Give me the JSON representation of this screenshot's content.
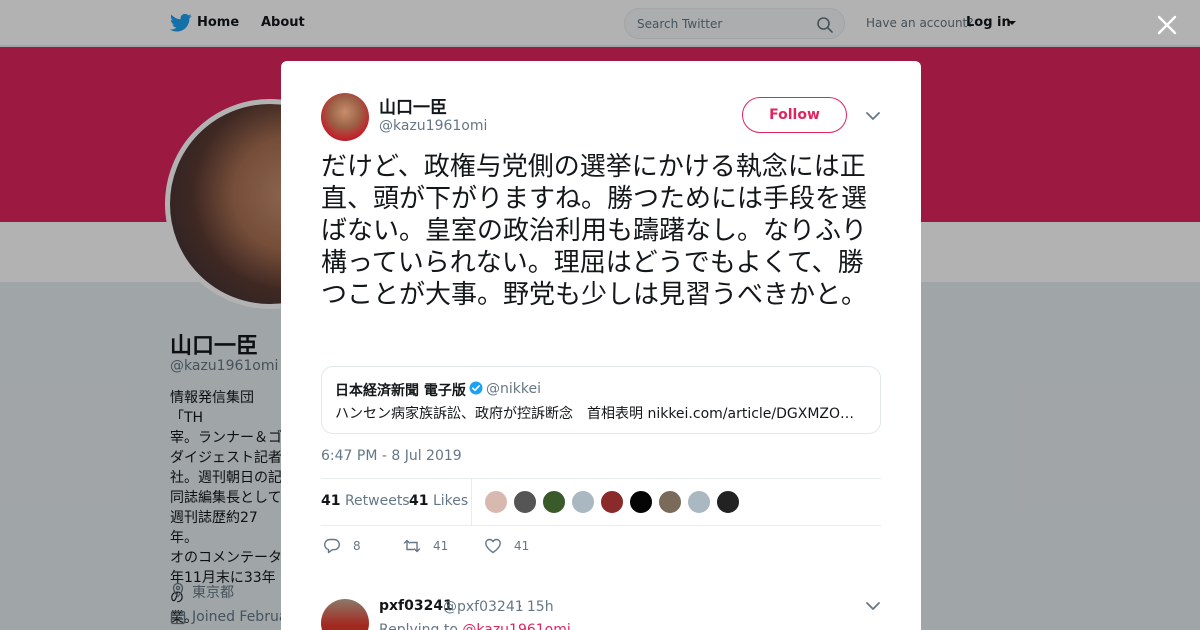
{
  "nav": {
    "home_label": "Home",
    "about_label": "About",
    "search_placeholder": "Search Twitter",
    "have_account": "Have an account?",
    "login_label": "Log in"
  },
  "profile": {
    "name": "山口一臣",
    "handle": "@kazu1961omi",
    "bio_visible": "情報発信集団「TH\n宰。ランナー＆ゴ\nダイジェスト記者\n社。週刊朝日の記\n同誌編集長として\n週刊誌歴約27年。\nオのコメンテータ\n年11月末に33年の\n業。",
    "location": "東京都",
    "joined": "Joined Februa"
  },
  "tweet": {
    "author_name": "山口一臣",
    "author_handle": "@kazu1961omi",
    "follow_label": "Follow",
    "text": "だけど、政権与党側の選挙にかける執念には正直、頭が下がりますね。勝つためには手段を選ばない。皇室の政治利用も躊躇なし。なりふり構っていられない。理屈はどうでもよくて、勝つことが大事。野党も少しは見習うべきかと。",
    "quote": {
      "name": "日本経済新聞 電子版",
      "handle": "@nikkei",
      "text": "ハンセン病家族訴訟、政府が控訴断念　首相表明 nikkei.com/article/DGXMZO…"
    },
    "timestamp": "6:47 PM - 8 Jul 2019",
    "retweets_count": "41",
    "retweets_label": "Retweets",
    "likes_count": "41",
    "likes_label": "Likes",
    "actions": {
      "reply_count": "8",
      "retweet_count": "41",
      "like_count": "41"
    }
  },
  "reply": {
    "name": "pxf03241",
    "handle": "@pxf03241",
    "time": "· 15h",
    "replying_to_label": "Replying to",
    "replying_to_handle": "@kazu1961omi"
  },
  "colors": {
    "accent": "#e0245e",
    "banner": "#e0245e",
    "link": "#1da1f2",
    "muted": "#657786"
  },
  "likers": [
    {
      "color": "#d8b9b0"
    },
    {
      "color": "#555555"
    },
    {
      "color": "#3a5a2a"
    },
    {
      "color": "#aab8c2"
    },
    {
      "color": "#8a2a2a"
    },
    {
      "color": "#050505"
    },
    {
      "color": "#7a6a5a"
    },
    {
      "color": "#aab8c2"
    },
    {
      "color": "#222222"
    }
  ]
}
